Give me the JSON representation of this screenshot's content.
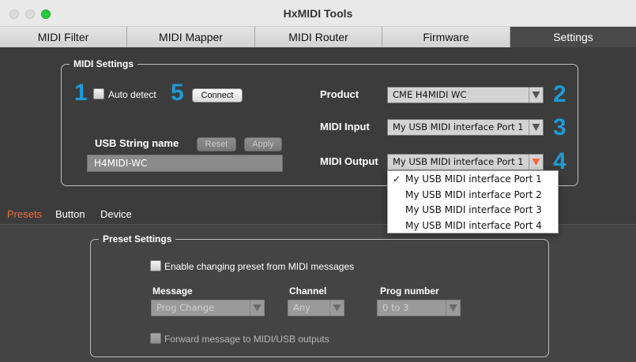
{
  "window": {
    "title": "HxMIDI Tools"
  },
  "tabs": [
    {
      "label": "MIDI Filter"
    },
    {
      "label": "MIDI Mapper"
    },
    {
      "label": "MIDI Router"
    },
    {
      "label": "Firmware"
    },
    {
      "label": "Settings"
    }
  ],
  "midi_settings": {
    "legend": "MIDI Settings",
    "auto_detect_label": "Auto detect",
    "auto_detect_checked": false,
    "connect_label": "Connect",
    "usb_string_label": "USB String name",
    "reset_label": "Reset",
    "apply_label": "Apply",
    "usb_string_value": "H4MIDI-WC",
    "product_label": "Product",
    "product_value": "CME H4MIDI WC",
    "midi_input_label": "MIDI Input",
    "midi_input_value": "My USB MIDI interface Port 1",
    "midi_output_label": "MIDI Output",
    "midi_output_value": "My USB MIDI interface Port 1"
  },
  "callouts": {
    "n1": "1",
    "n2": "2",
    "n3": "3",
    "n4": "4",
    "n5": "5"
  },
  "output_menu": {
    "check_mark": "✓",
    "selected_index": 0,
    "items": [
      "My USB MIDI interface Port 1",
      "My USB MIDI interface Port 2",
      "My USB MIDI interface Port 3",
      "My USB MIDI interface Port 4"
    ]
  },
  "subtabs": [
    {
      "label": "Presets"
    },
    {
      "label": "Button"
    },
    {
      "label": "Device"
    }
  ],
  "preset_settings": {
    "legend": "Preset Settings",
    "enable_label": "Enable changing preset from MIDI messages",
    "message_label": "Message",
    "message_value": "Prog Change",
    "channel_label": "Channel",
    "channel_value": "Any",
    "prog_label": "Prog number",
    "prog_value": "0 to 3",
    "forward_label": "Forward message to MIDI/USB outputs"
  },
  "colors": {
    "callout_blue": "#1c9ad6",
    "active_subtab": "#f06a3c",
    "output_arrow_active": "#f06a3c",
    "maximize_green": "#2ac93f"
  },
  "icons": {
    "dropdown_arrow": "triangle-down",
    "menu_check": "checkmark"
  }
}
